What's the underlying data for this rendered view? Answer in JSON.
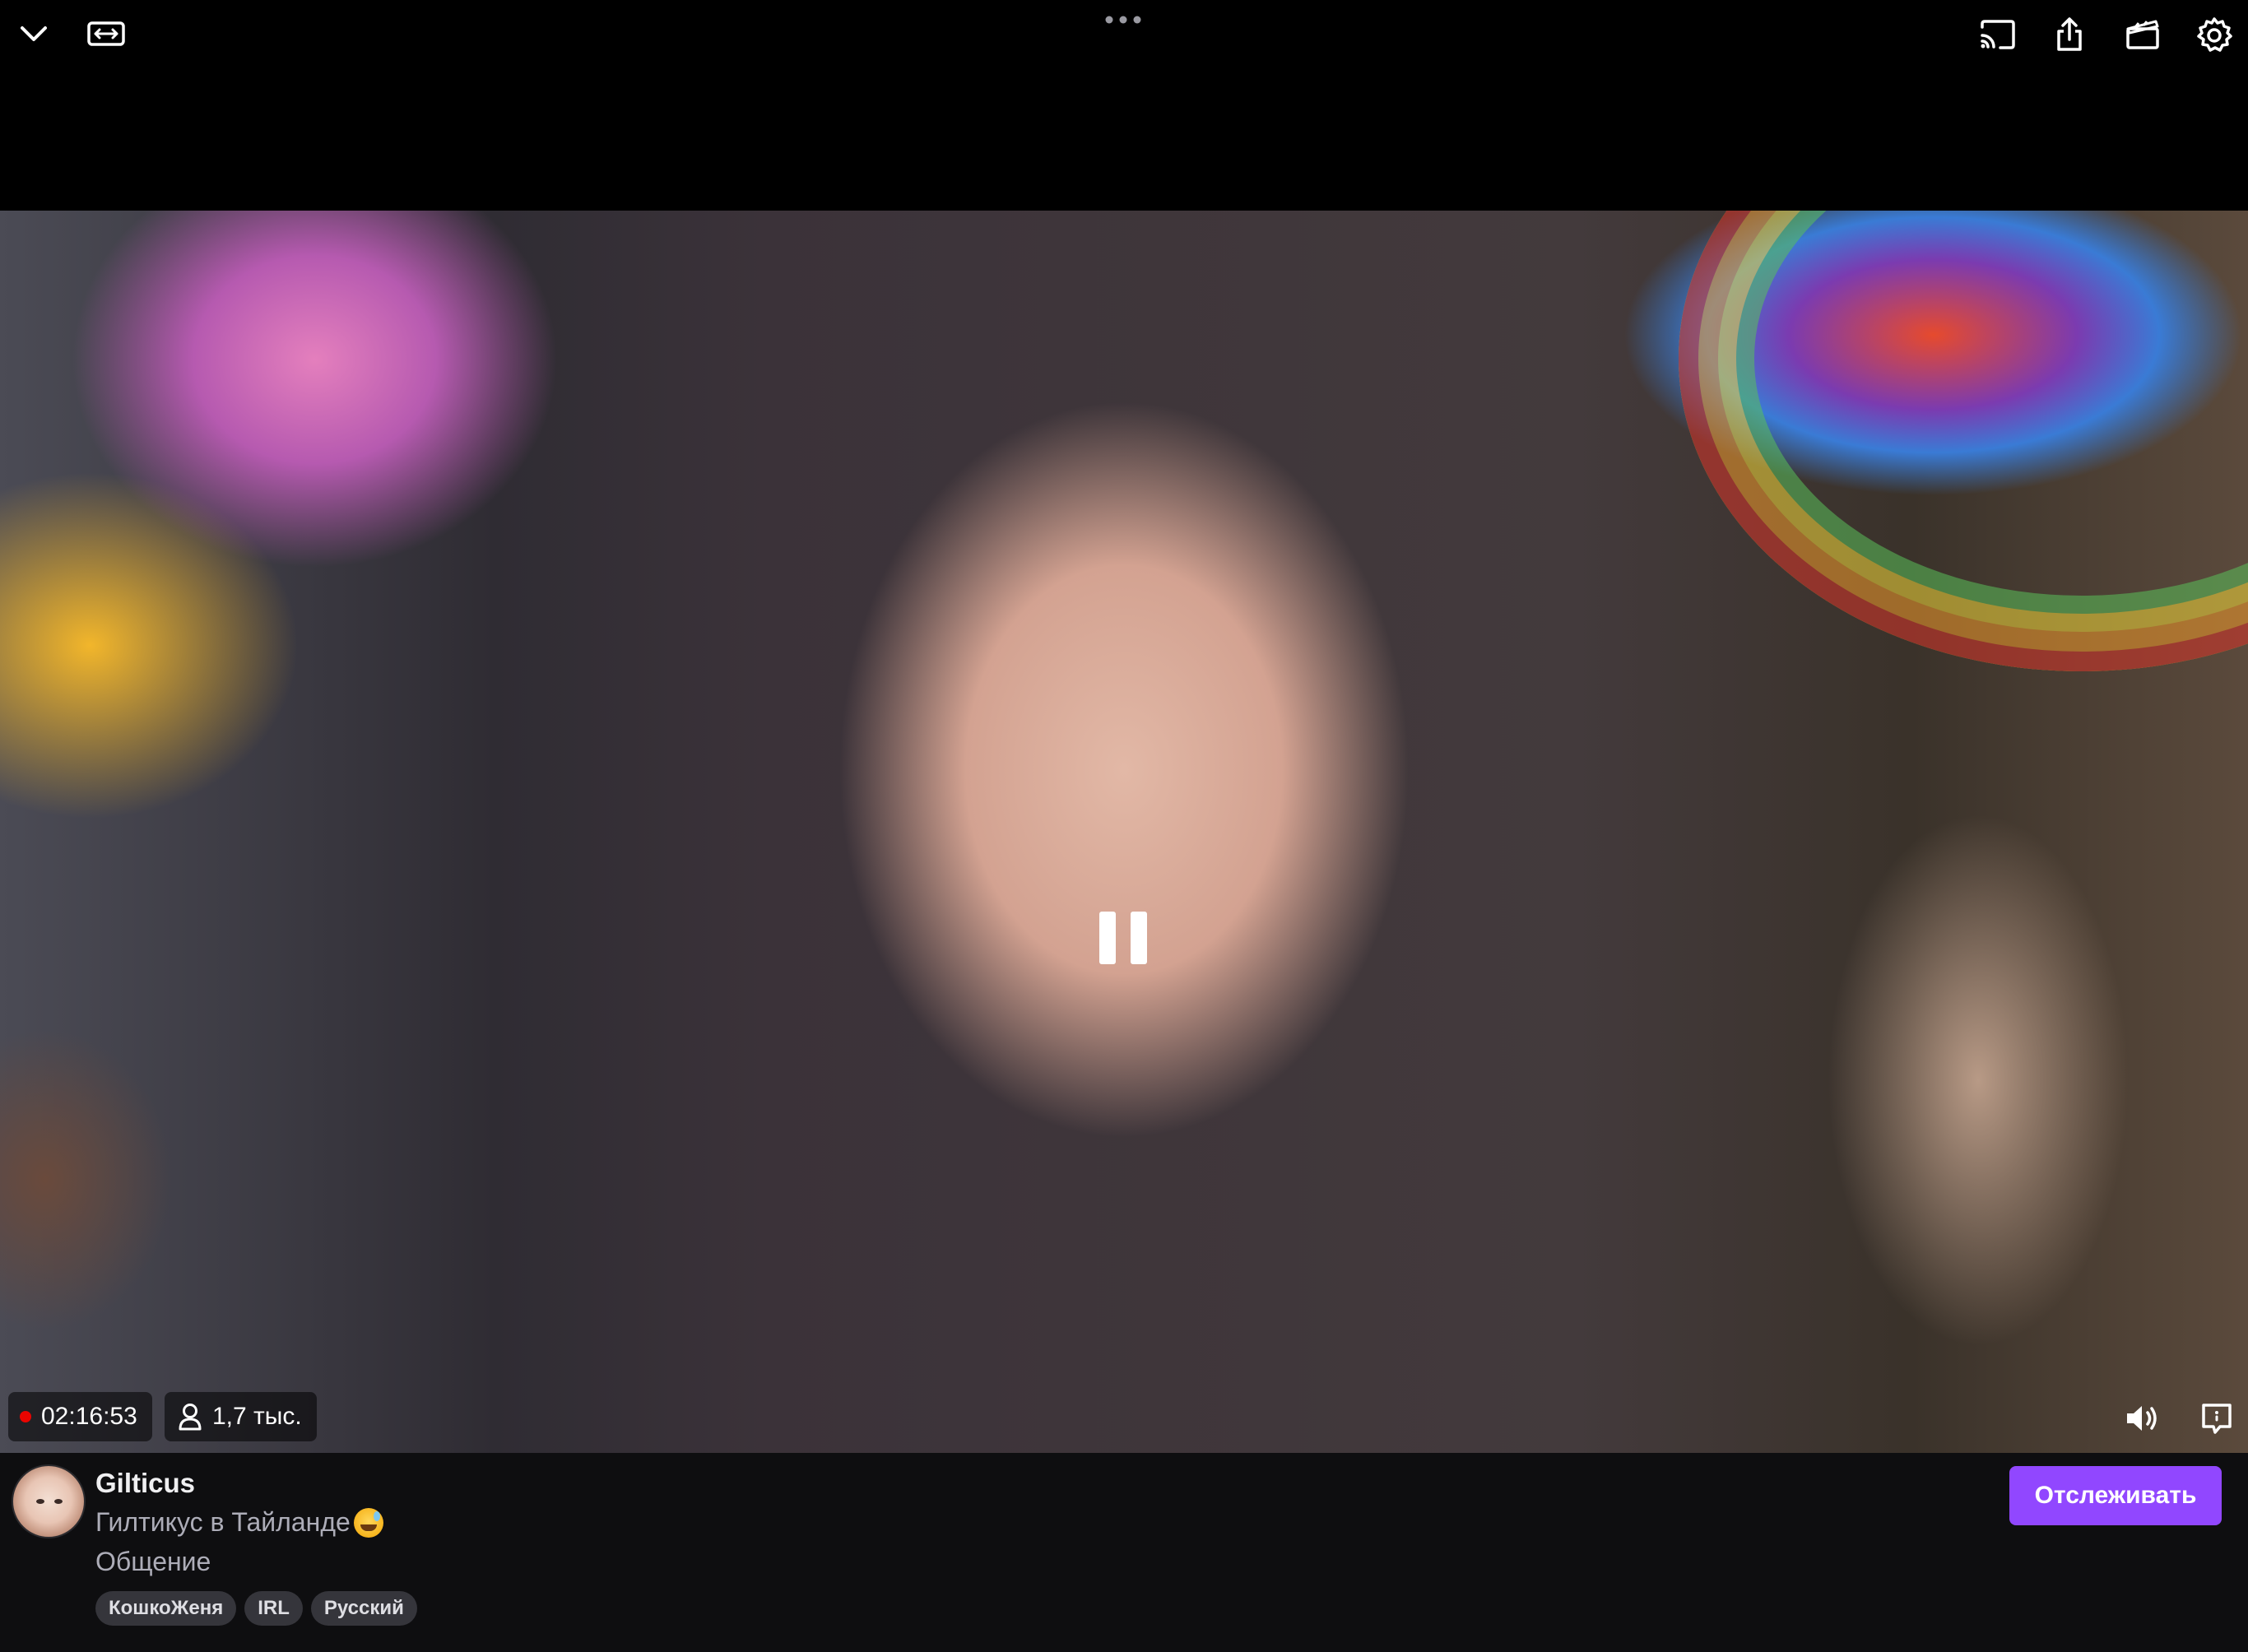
{
  "top_bar": {
    "icons": [
      "chevron-down-icon",
      "expand-horizontal-icon",
      "drag-handle-icon",
      "cast-icon",
      "share-icon",
      "clip-icon",
      "settings-icon"
    ]
  },
  "player": {
    "state": "playing",
    "overlay_icon": "pause-icon",
    "live_time": "02:16:53",
    "viewers": "1,7 тыс.",
    "live_dot_color": "#eb0400"
  },
  "stream_info": {
    "channel_name": "Gilticus",
    "title": "Гилтикус в Тайланде",
    "title_emoji": "sweat-smile-emoji",
    "category": "Общение",
    "tags": [
      "КошкоЖеня",
      "IRL",
      "Русский"
    ],
    "follow_label": "Отслеживать",
    "accent_color": "#9147ff"
  }
}
